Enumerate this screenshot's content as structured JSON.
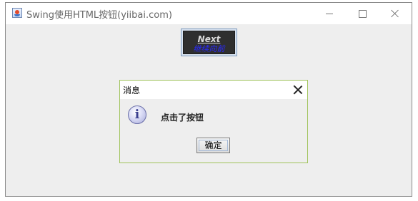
{
  "window": {
    "title": "Swing使用HTML按钮(yiibai.com)",
    "icon": "java-cup-icon",
    "controls": [
      "minimize-icon",
      "maximize-icon",
      "close-icon"
    ]
  },
  "main": {
    "next_button": {
      "label": "Next",
      "sublabel": "继续向前",
      "label_color": "#dcdcdc",
      "sublabel_color": "#2a2aff",
      "background": "#2f2f2f"
    }
  },
  "dialog": {
    "title": "消息",
    "icon": "info-icon",
    "icon_glyph": "i",
    "message": "点击了按钮",
    "ok_label": "确定",
    "border_color": "#9fc35a"
  }
}
